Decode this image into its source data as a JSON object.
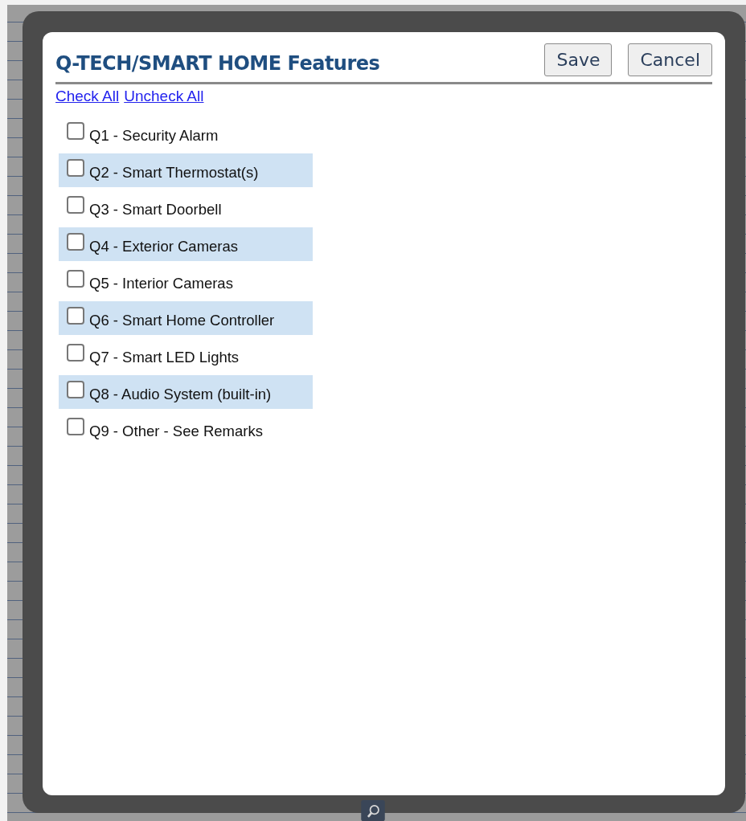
{
  "dialog": {
    "title": "Q-TECH/SMART HOME Features",
    "buttons": [
      {
        "label": "Save"
      },
      {
        "label": "Cancel"
      }
    ]
  },
  "links": [
    {
      "label": "Check All"
    },
    {
      "label": "Uncheck All"
    }
  ],
  "features": [
    {
      "label": "Q1 - Security Alarm",
      "checked": false
    },
    {
      "label": "Q2 - Smart Thermostat(s)",
      "checked": false
    },
    {
      "label": "Q3 - Smart Doorbell",
      "checked": false
    },
    {
      "label": "Q4 - Exterior Cameras",
      "checked": false
    },
    {
      "label": "Q5 - Interior Cameras",
      "checked": false
    },
    {
      "label": "Q6 - Smart Home Controller",
      "checked": false
    },
    {
      "label": "Q7 - Smart LED Lights",
      "checked": false
    },
    {
      "label": "Q8 - Audio System (built-in)",
      "checked": false
    },
    {
      "label": "Q9 - Other - See Remarks",
      "checked": false
    }
  ]
}
